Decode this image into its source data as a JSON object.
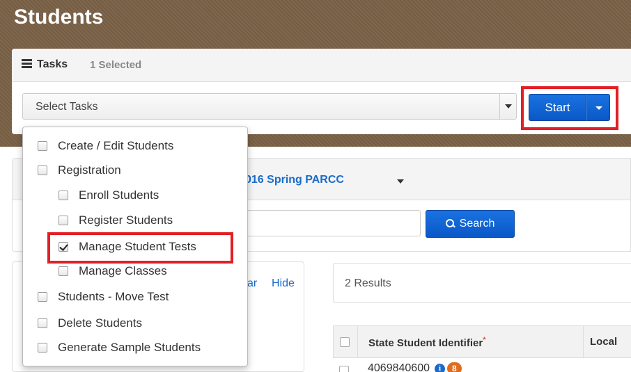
{
  "header": {
    "title": "Students"
  },
  "tasks": {
    "label": "Tasks",
    "selected_count": "1 Selected",
    "select_placeholder": "Select Tasks",
    "start_label": "Start"
  },
  "admin": {
    "label": "016 Spring PARCC"
  },
  "search": {
    "button_label": "Search"
  },
  "filters": {
    "clear_label": "ar",
    "hide_label": "Hide"
  },
  "results": {
    "summary": "2 Results",
    "columns": [
      "State Student Identifier",
      "Local"
    ],
    "required_marker": "*",
    "first_row": {
      "id": "4069840600",
      "info": "i",
      "badge": "8"
    }
  },
  "task_menu": {
    "items": [
      {
        "label": "Create / Edit Students",
        "checked": false,
        "indent": 0
      },
      {
        "label": "Registration",
        "checked": false,
        "indent": 0
      },
      {
        "label": "Enroll Students",
        "checked": false,
        "indent": 1
      },
      {
        "label": "Register Students",
        "checked": false,
        "indent": 1
      },
      {
        "label": "Manage Student Tests",
        "checked": true,
        "indent": 1
      },
      {
        "label": "Manage Classes",
        "checked": false,
        "indent": 1
      },
      {
        "label": "Students - Move Test",
        "checked": false,
        "indent": 0
      },
      {
        "label": "Delete Students",
        "checked": false,
        "indent": 0
      },
      {
        "label": "Generate Sample Students",
        "checked": false,
        "indent": 0
      }
    ]
  },
  "colors": {
    "header_bg": "#7a6147",
    "primary_button": "#0a58c8",
    "highlight_border": "#e21f26",
    "link": "#1a6bc9",
    "badge": "#e06d1f"
  }
}
